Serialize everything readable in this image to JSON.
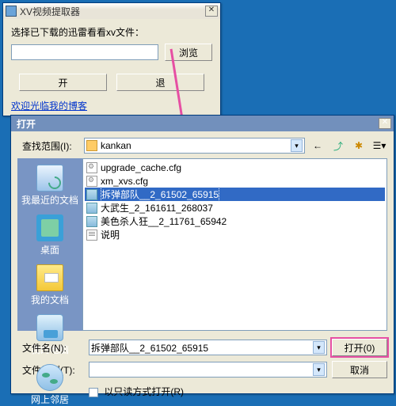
{
  "extractor": {
    "title": "XV视频提取器",
    "instruction": "选择已下载的迅雷看看xv文件：",
    "browse": "浏览",
    "open": "开",
    "back": "退",
    "blog_link": "欢迎光临我的博客"
  },
  "opendlg": {
    "title": "打开",
    "look_in_label": "查找范围(I):",
    "folder": "kankan",
    "files": [
      {
        "name": "upgrade_cache.cfg",
        "type": "cfg"
      },
      {
        "name": "xm_xvs.cfg",
        "type": "cfg"
      },
      {
        "name": "拆弹部队__2_61502_65915",
        "type": "vid",
        "selected": true
      },
      {
        "name": "大武生_2_161611_268037",
        "type": "vid"
      },
      {
        "name": "美色杀人狂__2_11761_65942",
        "type": "vid"
      },
      {
        "name": "说明",
        "type": "txt"
      }
    ],
    "sidebar": [
      "我最近的文档",
      "桌面",
      "我的文档",
      "我的电脑",
      "网上邻居"
    ],
    "filename_label": "文件名(N):",
    "filetype_label": "文件类型(T):",
    "filename_value": "拆弹部队__2_61502_65915",
    "filetype_value": "",
    "readonly": "以只读方式打开(R)",
    "open_btn": "打开(0)",
    "cancel_btn": "取消"
  }
}
